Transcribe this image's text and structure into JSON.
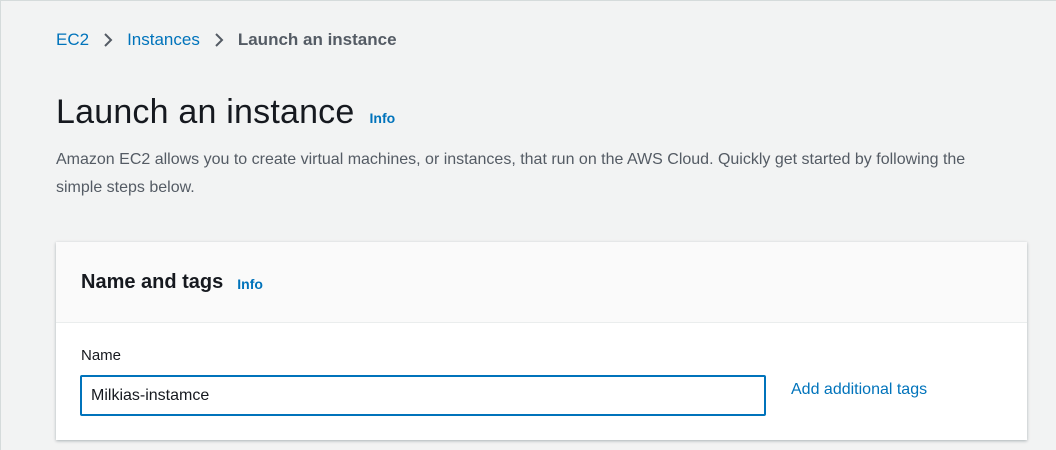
{
  "breadcrumb": {
    "items": [
      {
        "label": "EC2"
      },
      {
        "label": "Instances"
      },
      {
        "label": "Launch an instance"
      }
    ]
  },
  "header": {
    "title": "Launch an instance",
    "info_label": "Info",
    "description": "Amazon EC2 allows you to create virtual machines, or instances, that run on the AWS Cloud. Quickly get started by following the simple steps below."
  },
  "name_and_tags": {
    "title": "Name and tags",
    "info_label": "Info",
    "name_label": "Name",
    "name_value": "Milkias-instamce",
    "add_tags_label": "Add additional tags"
  },
  "colors": {
    "link": "#0073bb",
    "background": "#f2f3f3",
    "focus_border": "#0073bb"
  }
}
